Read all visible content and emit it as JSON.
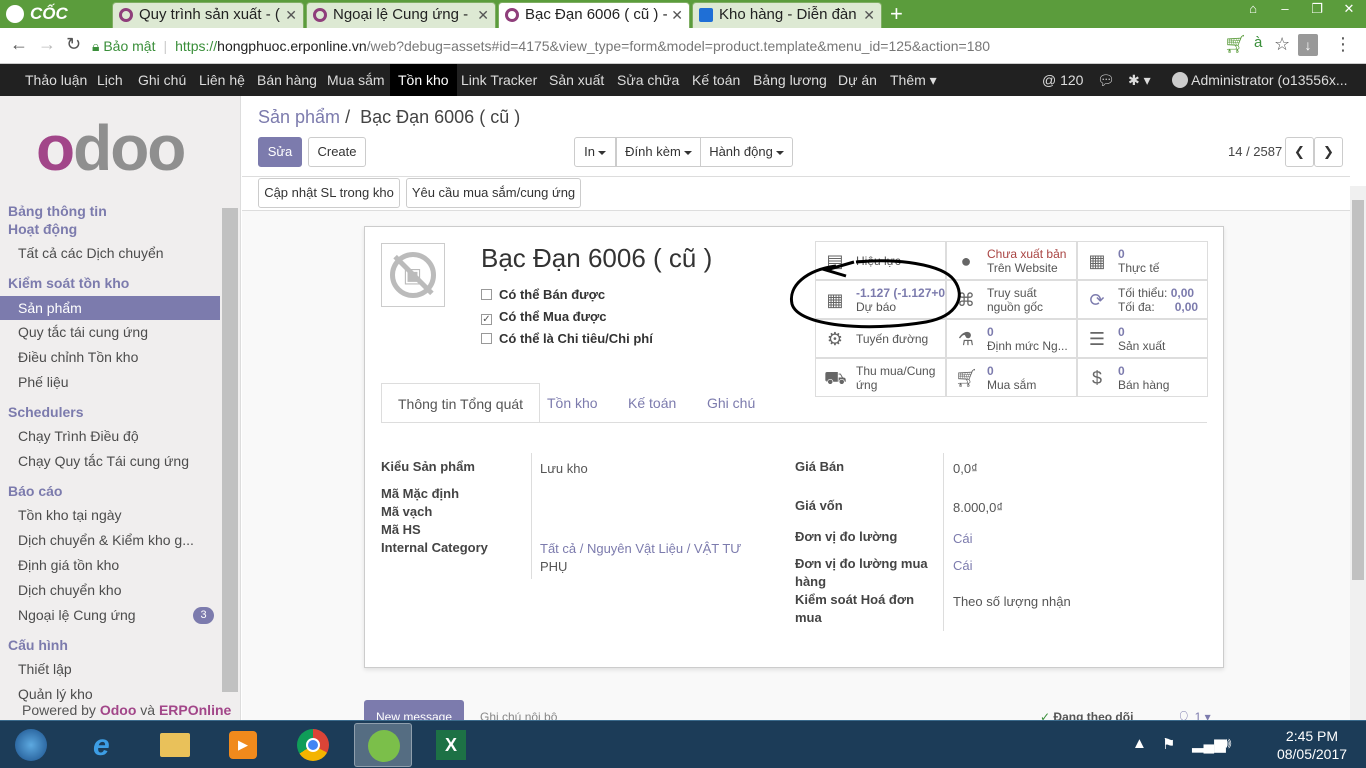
{
  "browser": {
    "brand": "CỐC CỐC",
    "tabs": [
      {
        "title": "Quy trình sản xuất - (",
        "active": false
      },
      {
        "title": "Ngoại lệ Cung ứng -",
        "active": false
      },
      {
        "title": "Bạc Đạn 6006 ( cũ ) -",
        "active": true
      },
      {
        "title": "Kho hàng - Diễn đàn",
        "active": false
      }
    ],
    "url": {
      "secure_label": "Bảo mật",
      "scheme": "https://",
      "host": "hongphuoc.erponline.vn",
      "path": "/web?debug=assets#id=4175&view_type=form&model=product.template&menu_id=125&action=180"
    }
  },
  "topmenu": {
    "items": [
      "Thảo luận",
      "Lịch",
      "Ghi chú",
      "Liên hệ",
      "Bán hàng",
      "Mua sắm",
      "Tồn kho",
      "Link Tracker",
      "Sản xuất",
      "Sửa chữa",
      "Kế toán",
      "Bảng lương",
      "Dự án",
      "Thêm"
    ],
    "active_index": 6,
    "messages_count": "120",
    "user": "Administrator (o13556x..."
  },
  "sidebar": {
    "sections": [
      {
        "heading": "Bảng thông tin",
        "items": []
      },
      {
        "heading": "Hoạt động",
        "items": [
          "Tất cả các Dịch chuyển"
        ]
      },
      {
        "heading": "Kiểm soát tồn kho",
        "items": [
          "Sản phẩm",
          "Quy tắc tái cung ứng",
          "Điều chỉnh Tồn kho",
          "Phế liệu"
        ]
      },
      {
        "heading": "Schedulers",
        "items": [
          "Chạy Trình Điều độ",
          "Chạy Quy tắc Tái cung ứng"
        ]
      },
      {
        "heading": "Báo cáo",
        "items": [
          "Tồn kho tại ngày",
          "Dịch chuyển & Kiểm kho g...",
          "Định giá tồn kho",
          "Dịch chuyển kho",
          "Ngoại lệ Cung ứng"
        ]
      },
      {
        "heading": "Cấu hình",
        "items": [
          "Thiết lập",
          "Quản lý kho"
        ]
      }
    ],
    "active_item": "Sản phẩm",
    "exceptions_badge": "3",
    "powered_prefix": "Powered by",
    "powered_odoo": "Odoo",
    "powered_and": "và",
    "powered_erp": "ERPOnline"
  },
  "form": {
    "breadcrumb_parent": "Sản phẩm",
    "breadcrumb_sep": "/",
    "breadcrumb_current": "Bạc Đạn 6006 ( cũ )",
    "edit_label": "Sửa",
    "create_label": "Create",
    "print_label": "In",
    "attach_label": "Đính kèm",
    "action_label": "Hành động",
    "pager": "14 / 2587",
    "header_buttons": [
      "Cập nhật SL trong kho",
      "Yêu cầu mua sắm/cung ứng"
    ],
    "product_name": "Bạc Đạn 6006 ( cũ )",
    "checkboxes": [
      {
        "label": "Có thể Bán được",
        "checked": false
      },
      {
        "label": "Có thể Mua được",
        "checked": true
      },
      {
        "label": "Có thể là Chi tiêu/Chi phí",
        "checked": false
      }
    ],
    "stats": [
      {
        "icon": "archive-icon",
        "line1": "",
        "line2": "Hiệu lực"
      },
      {
        "icon": "globe-icon",
        "line1": "Chưa xuất bản",
        "line2": "Trên Website"
      },
      {
        "icon": "building-icon",
        "line1": "0",
        "line2": "Thực tế"
      },
      {
        "icon": "building-icon",
        "line1": "-1.127 (-1.127+0",
        "line2": "Dự báo"
      },
      {
        "icon": "sitemap-icon",
        "line1": "Truy suất",
        "line2": "nguồn gốc"
      },
      {
        "icon": "refresh-icon",
        "line1": "Tối thiểu:",
        "line1b": "0,00",
        "line2": "Tối đa:",
        "line2b": "0,00"
      },
      {
        "icon": "cogs-icon",
        "line1": "",
        "line2": "Tuyến đường"
      },
      {
        "icon": "flask-icon",
        "line1": "0",
        "line2": "Định mức Ng..."
      },
      {
        "icon": "list-icon",
        "line1": "0",
        "line2": "Sản xuất"
      },
      {
        "icon": "truck-icon",
        "line1": "Thu mua/Cung",
        "line2": "ứng"
      },
      {
        "icon": "cart-icon",
        "line1": "0",
        "line2": "Mua sắm"
      },
      {
        "icon": "dollar-icon",
        "line1": "0",
        "line2": "Bán hàng"
      }
    ],
    "tabs": [
      "Thông tin Tổng quát",
      "Tồn kho",
      "Kế toán",
      "Ghi chú"
    ],
    "fields_left": [
      {
        "label": "Kiểu Sản phẩm",
        "value": "Lưu kho"
      },
      {
        "label": "Mã Mặc định",
        "value": ""
      },
      {
        "label": "Mã vạch",
        "value": ""
      },
      {
        "label": "Mã HS",
        "value": ""
      },
      {
        "label": "Internal Category",
        "value": "Tất cả / Nguyên Vật Liệu / VẬT TƯ",
        "value2": "PHỤ"
      }
    ],
    "fields_right": [
      {
        "label": "Giá Bán",
        "value": "0,0₫"
      },
      {
        "label": "Giá vốn",
        "value": "8.000,0₫"
      },
      {
        "label": "Đơn vị đo lường",
        "value": "Cái"
      },
      {
        "label": "Đơn vị đo lường mua",
        "label2": "hàng",
        "value": "Cái"
      },
      {
        "label": "Kiểm soát Hoá đơn",
        "label2": "mua",
        "value": "Theo số lượng nhận"
      }
    ]
  },
  "chatter": {
    "new_message": "New message",
    "log_note": "Ghi chú nội bộ",
    "following": "Đang theo dõi",
    "followers": "1"
  },
  "taskbar": {
    "time": "2:45 PM",
    "date": "08/05/2017"
  }
}
